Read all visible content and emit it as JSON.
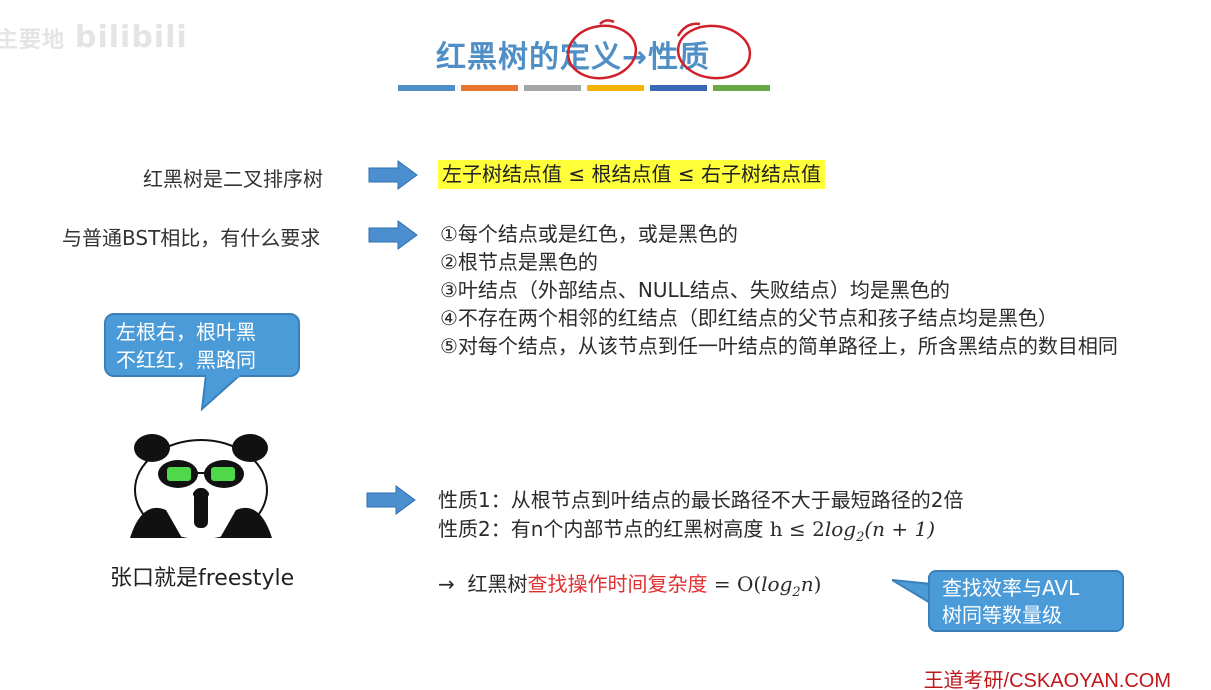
{
  "watermark": {
    "cn": "主要地",
    "logo": "bilibili"
  },
  "title": {
    "prefix": "红黑树的",
    "def": "定义",
    "arrow": "→",
    "prop": "性质"
  },
  "color_bars": [
    "#4f8fc6",
    "#e8762d",
    "#a5a5a5",
    "#f5b400",
    "#3a68b5",
    "#6aa845"
  ],
  "row1": {
    "label": "红黑树是二叉排序树",
    "highlight": "左子树结点值 ≤ 根结点值 ≤ 右子树结点值"
  },
  "row2": {
    "label": "与普通BST相比，有什么要求"
  },
  "rules": [
    "①每个结点或是红色，或是黑色的",
    "②根节点是黑色的",
    "③叶结点（外部结点、NULL结点、失败结点）均是黑色的",
    "④不存在两个相邻的红结点（即红结点的父节点和孩子结点均是黑色）",
    "⑤对每个结点，从该节点到任一叶结点的简单路径上，所含黑结点的数目相同"
  ],
  "bubble": {
    "line1": "左根右，根叶黑",
    "line2": "不红红，黑路同"
  },
  "panda_caption": "张口就是freestyle",
  "properties": {
    "p1": "性质1：从根节点到叶结点的最长路径不大于最短路径的2倍",
    "p2_prefix": "性质2：有n个内部节点的红黑树高度 ",
    "p2_h": "h ≤ 2",
    "p2_log": "log",
    "p2_sub": "2",
    "p2_tail": "(n + 1)"
  },
  "conclusion": {
    "arrow": "→",
    "prefix": "红黑树",
    "red": "查找操作时间复杂度",
    "eq": " = O(",
    "log": "log",
    "sub": "2",
    "n": "n",
    "close": ")"
  },
  "callout": {
    "line1": "查找效率与AVL",
    "line2": "树同等数量级"
  },
  "footer": "王道考研/CSKAOYAN.COM"
}
